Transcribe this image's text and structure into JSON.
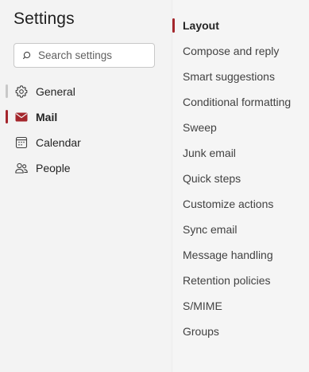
{
  "header": {
    "title": "Settings"
  },
  "search": {
    "placeholder": "Search settings",
    "icon": "search-icon"
  },
  "colors": {
    "accent": "#a4262c",
    "inactive_indicator": "#c8c8c8"
  },
  "sidebar": {
    "items": [
      {
        "label": "General",
        "icon": "gear-icon",
        "selected": false,
        "indicator": "inactive"
      },
      {
        "label": "Mail",
        "icon": "mail-icon",
        "selected": true,
        "indicator": "accent"
      },
      {
        "label": "Calendar",
        "icon": "calendar-icon",
        "selected": false
      },
      {
        "label": "People",
        "icon": "people-icon",
        "selected": false
      }
    ]
  },
  "subnav": {
    "items": [
      {
        "label": "Layout",
        "selected": true
      },
      {
        "label": "Compose and reply"
      },
      {
        "label": "Smart suggestions"
      },
      {
        "label": "Conditional formatting"
      },
      {
        "label": "Sweep"
      },
      {
        "label": "Junk email"
      },
      {
        "label": "Quick steps"
      },
      {
        "label": "Customize actions"
      },
      {
        "label": "Sync email"
      },
      {
        "label": "Message handling"
      },
      {
        "label": "Retention policies"
      },
      {
        "label": "S/MIME"
      },
      {
        "label": "Groups"
      }
    ]
  }
}
